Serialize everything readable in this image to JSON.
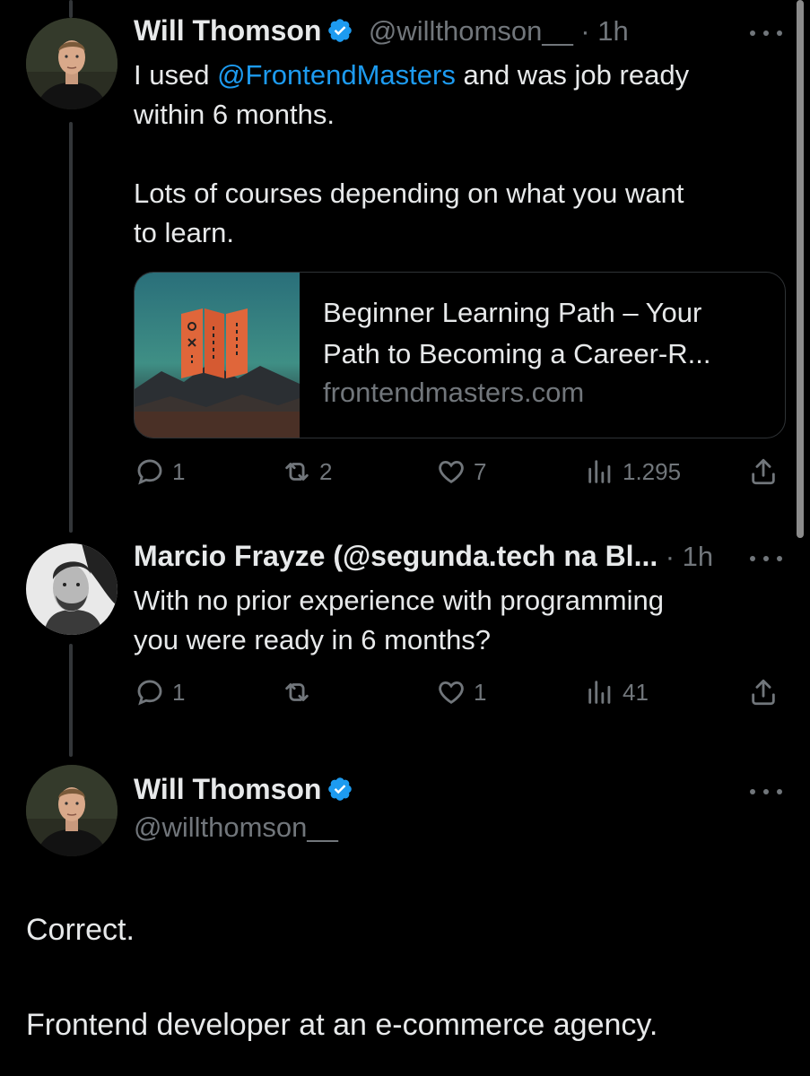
{
  "tweet1": {
    "author_name": "Will Thomson",
    "handle": "@willthomson__",
    "time": "· 1h",
    "text_pre": "I used ",
    "mention": "@FrontendMasters",
    "text_post": " and was job ready",
    "text_line2": "within 6 months.",
    "text_line3": "Lots of courses depending on what you want",
    "text_line4": "to learn.",
    "card": {
      "title_line1": "Beginner Learning Path – Your",
      "title_line2": "Path to Becoming a Career-R...",
      "domain": "frontendmasters.com"
    },
    "replies": "1",
    "reposts": "2",
    "likes": "7",
    "views": "1.295"
  },
  "tweet2": {
    "author_name": "Marcio Frayze (@segunda.tech na Bl...",
    "time": "· 1h",
    "text_line1": "With no prior experience with programming",
    "text_line2": "you were ready in 6 months?",
    "replies": "1",
    "reposts": "",
    "likes": "1",
    "views": "41"
  },
  "tweet3": {
    "author_name": "Will Thomson",
    "handle": "@willthomson__",
    "text_line1": "Correct.",
    "text_line2": "Frontend developer at an e-commerce agency."
  },
  "colors": {
    "background": "#000000",
    "text": "#e7e9ea",
    "muted": "#71767b",
    "link": "#1d9bf0",
    "verified": "#1d9bf0"
  },
  "icons": [
    "verified-badge-icon",
    "more-icon",
    "reply-icon",
    "repost-icon",
    "like-icon",
    "views-icon",
    "share-icon"
  ]
}
